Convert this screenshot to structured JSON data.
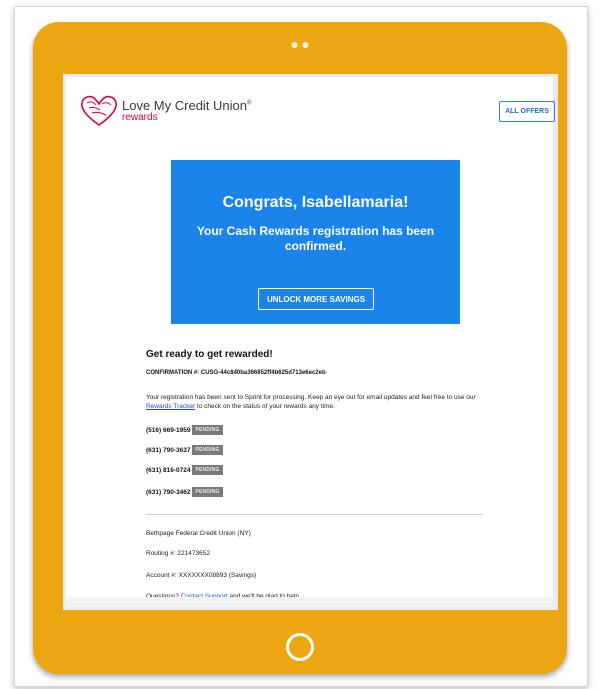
{
  "brand": {
    "name": "Love My Credit Union",
    "reg": "®",
    "sub": "rewards",
    "logo_text": "LOVE MY CREDIT UNION"
  },
  "header": {
    "all_offers": "ALL OFFERS"
  },
  "hero": {
    "title": "Congrats, Isabellamaria!",
    "subtitle": "Your Cash Rewards registration has been confirmed.",
    "button": "UNLOCK MORE SAVINGS"
  },
  "content": {
    "heading": "Get ready to get rewarded!",
    "confirmation": "CONFIRMATION #: CUSG-44c840ba366852ff4b625d713e6ec2eb",
    "body_before": "Your registration has been sent to Sprint for processing. Keep an eye out for email updates and feel free to use our ",
    "body_link": "Rewards Tracker",
    "body_after": " to check on the status of your rewards any time.",
    "phones": [
      {
        "number": "(516) 669-1959",
        "status": "PENDING"
      },
      {
        "number": "(631) 790-3637",
        "status": "PENDING"
      },
      {
        "number": "(631) 816-0724",
        "status": "PENDING"
      },
      {
        "number": "(631) 790-3462",
        "status": "PENDING"
      }
    ]
  },
  "footer": {
    "credit_union": "Bethpage Federal Credit Union (NY)",
    "routing": "Routing #: 221473652",
    "account": "Account #: XXXXXXX08893 (Savings)",
    "questions_before": "Questions? ",
    "questions_link": "Contact Support",
    "questions_after": " and we'll be glad to help."
  },
  "colors": {
    "tablet": "#eba612",
    "hero": "#1a84ea",
    "brand_red": "#e0003c",
    "link": "#1a4fd1",
    "badge": "#7b7b7b"
  }
}
